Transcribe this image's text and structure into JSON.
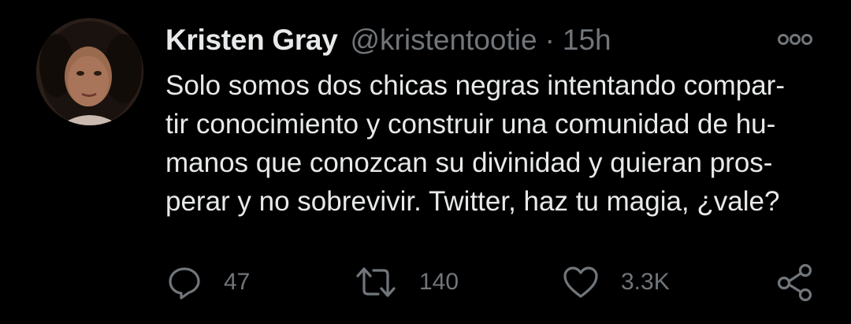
{
  "tweet": {
    "author_name": "Kristen Gray",
    "handle": "@kristentootie",
    "separator": "·",
    "time": "15h",
    "text_lines": [
      "Solo somos dos chicas negras intentando compar-",
      "tir conocimiento y construir una comunidad de hu-",
      "manos que conozcan su divinidad y quieran pros-",
      "perar y no sobrevivir. Twitter, haz tu magia, ¿vale?"
    ]
  },
  "actions": {
    "reply": {
      "icon": "reply-icon",
      "count": "47"
    },
    "retweet": {
      "icon": "retweet-icon",
      "count": "140"
    },
    "like": {
      "icon": "heart-icon",
      "count": "3.3K"
    },
    "share": {
      "icon": "share-icon"
    }
  },
  "more_menu": {
    "icon": "more-options-icon"
  },
  "colors": {
    "background": "#000000",
    "primary_text": "#e7e9ea",
    "secondary_text": "#71767b"
  }
}
